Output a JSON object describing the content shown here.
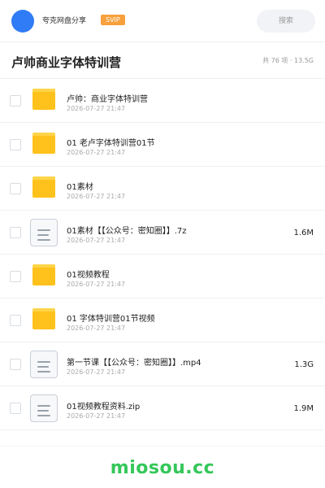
{
  "header": {
    "user_name": "夸克网盘分享",
    "svip": "SVIP",
    "search_placeholder": "搜索"
  },
  "share": {
    "title": "卢帅商业字体特训营",
    "meta": "共 76 项 · 13.5G"
  },
  "files": [
    {
      "type": "folder",
      "name": "卢帅：商业字体特训营",
      "date": "2026-07-27 21:47",
      "size": ""
    },
    {
      "type": "folder",
      "name": "01 老卢字体特训营01节",
      "date": "2026-07-27 21:47",
      "size": ""
    },
    {
      "type": "folder",
      "name": "01素材",
      "date": "2026-07-27 21:47",
      "size": ""
    },
    {
      "type": "file",
      "name": "01素材【【公众号：密知圈】】.7z",
      "date": "2026-07-27 21:47",
      "size": "1.6M"
    },
    {
      "type": "folder",
      "name": "01视频教程",
      "date": "2026-07-27 21:47",
      "size": ""
    },
    {
      "type": "folder",
      "name": "01 字体特训营01节视频",
      "date": "2026-07-27 21:47",
      "size": ""
    },
    {
      "type": "file",
      "name": "第一节课【【公众号：密知圈】】.mp4",
      "date": "2026-07-27 21:47",
      "size": "1.3G"
    },
    {
      "type": "file",
      "name": "01视频教程资料.zip",
      "date": "2026-07-27 21:47",
      "size": "1.9M"
    }
  ],
  "watermark": "miosou.cc",
  "colors": {
    "accent": "#2f7cf6",
    "svip": "#f7a03c",
    "folder": "#ffc21c",
    "watermark": "#34c759"
  }
}
